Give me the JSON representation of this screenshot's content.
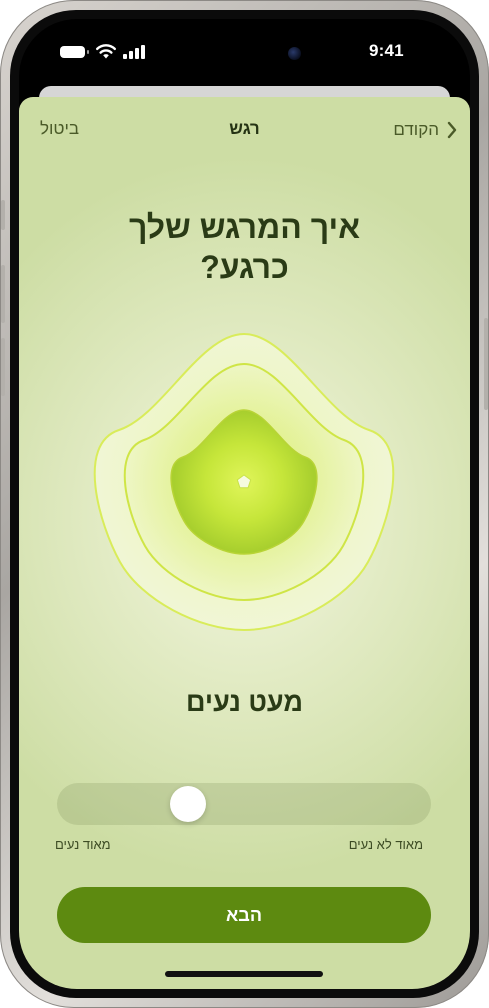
{
  "status_bar": {
    "time": "9:41"
  },
  "nav": {
    "back_label": "הקודם",
    "title": "רגש",
    "cancel_label": "ביטול"
  },
  "question": {
    "line1": "איך המרגש שלך",
    "line2": "כרגע?"
  },
  "mood": {
    "label": "מעט נעים",
    "accent_color": "#c8e63c"
  },
  "slider": {
    "value_fraction": 0.67,
    "right_label": "מאוד לא נעים",
    "left_label": "מאוד נעים"
  },
  "next_button": {
    "label": "הבא",
    "color": "#5d8a10"
  },
  "icons": [
    "battery-icon",
    "wifi-icon",
    "cellular-icon",
    "chevron-right-icon"
  ]
}
